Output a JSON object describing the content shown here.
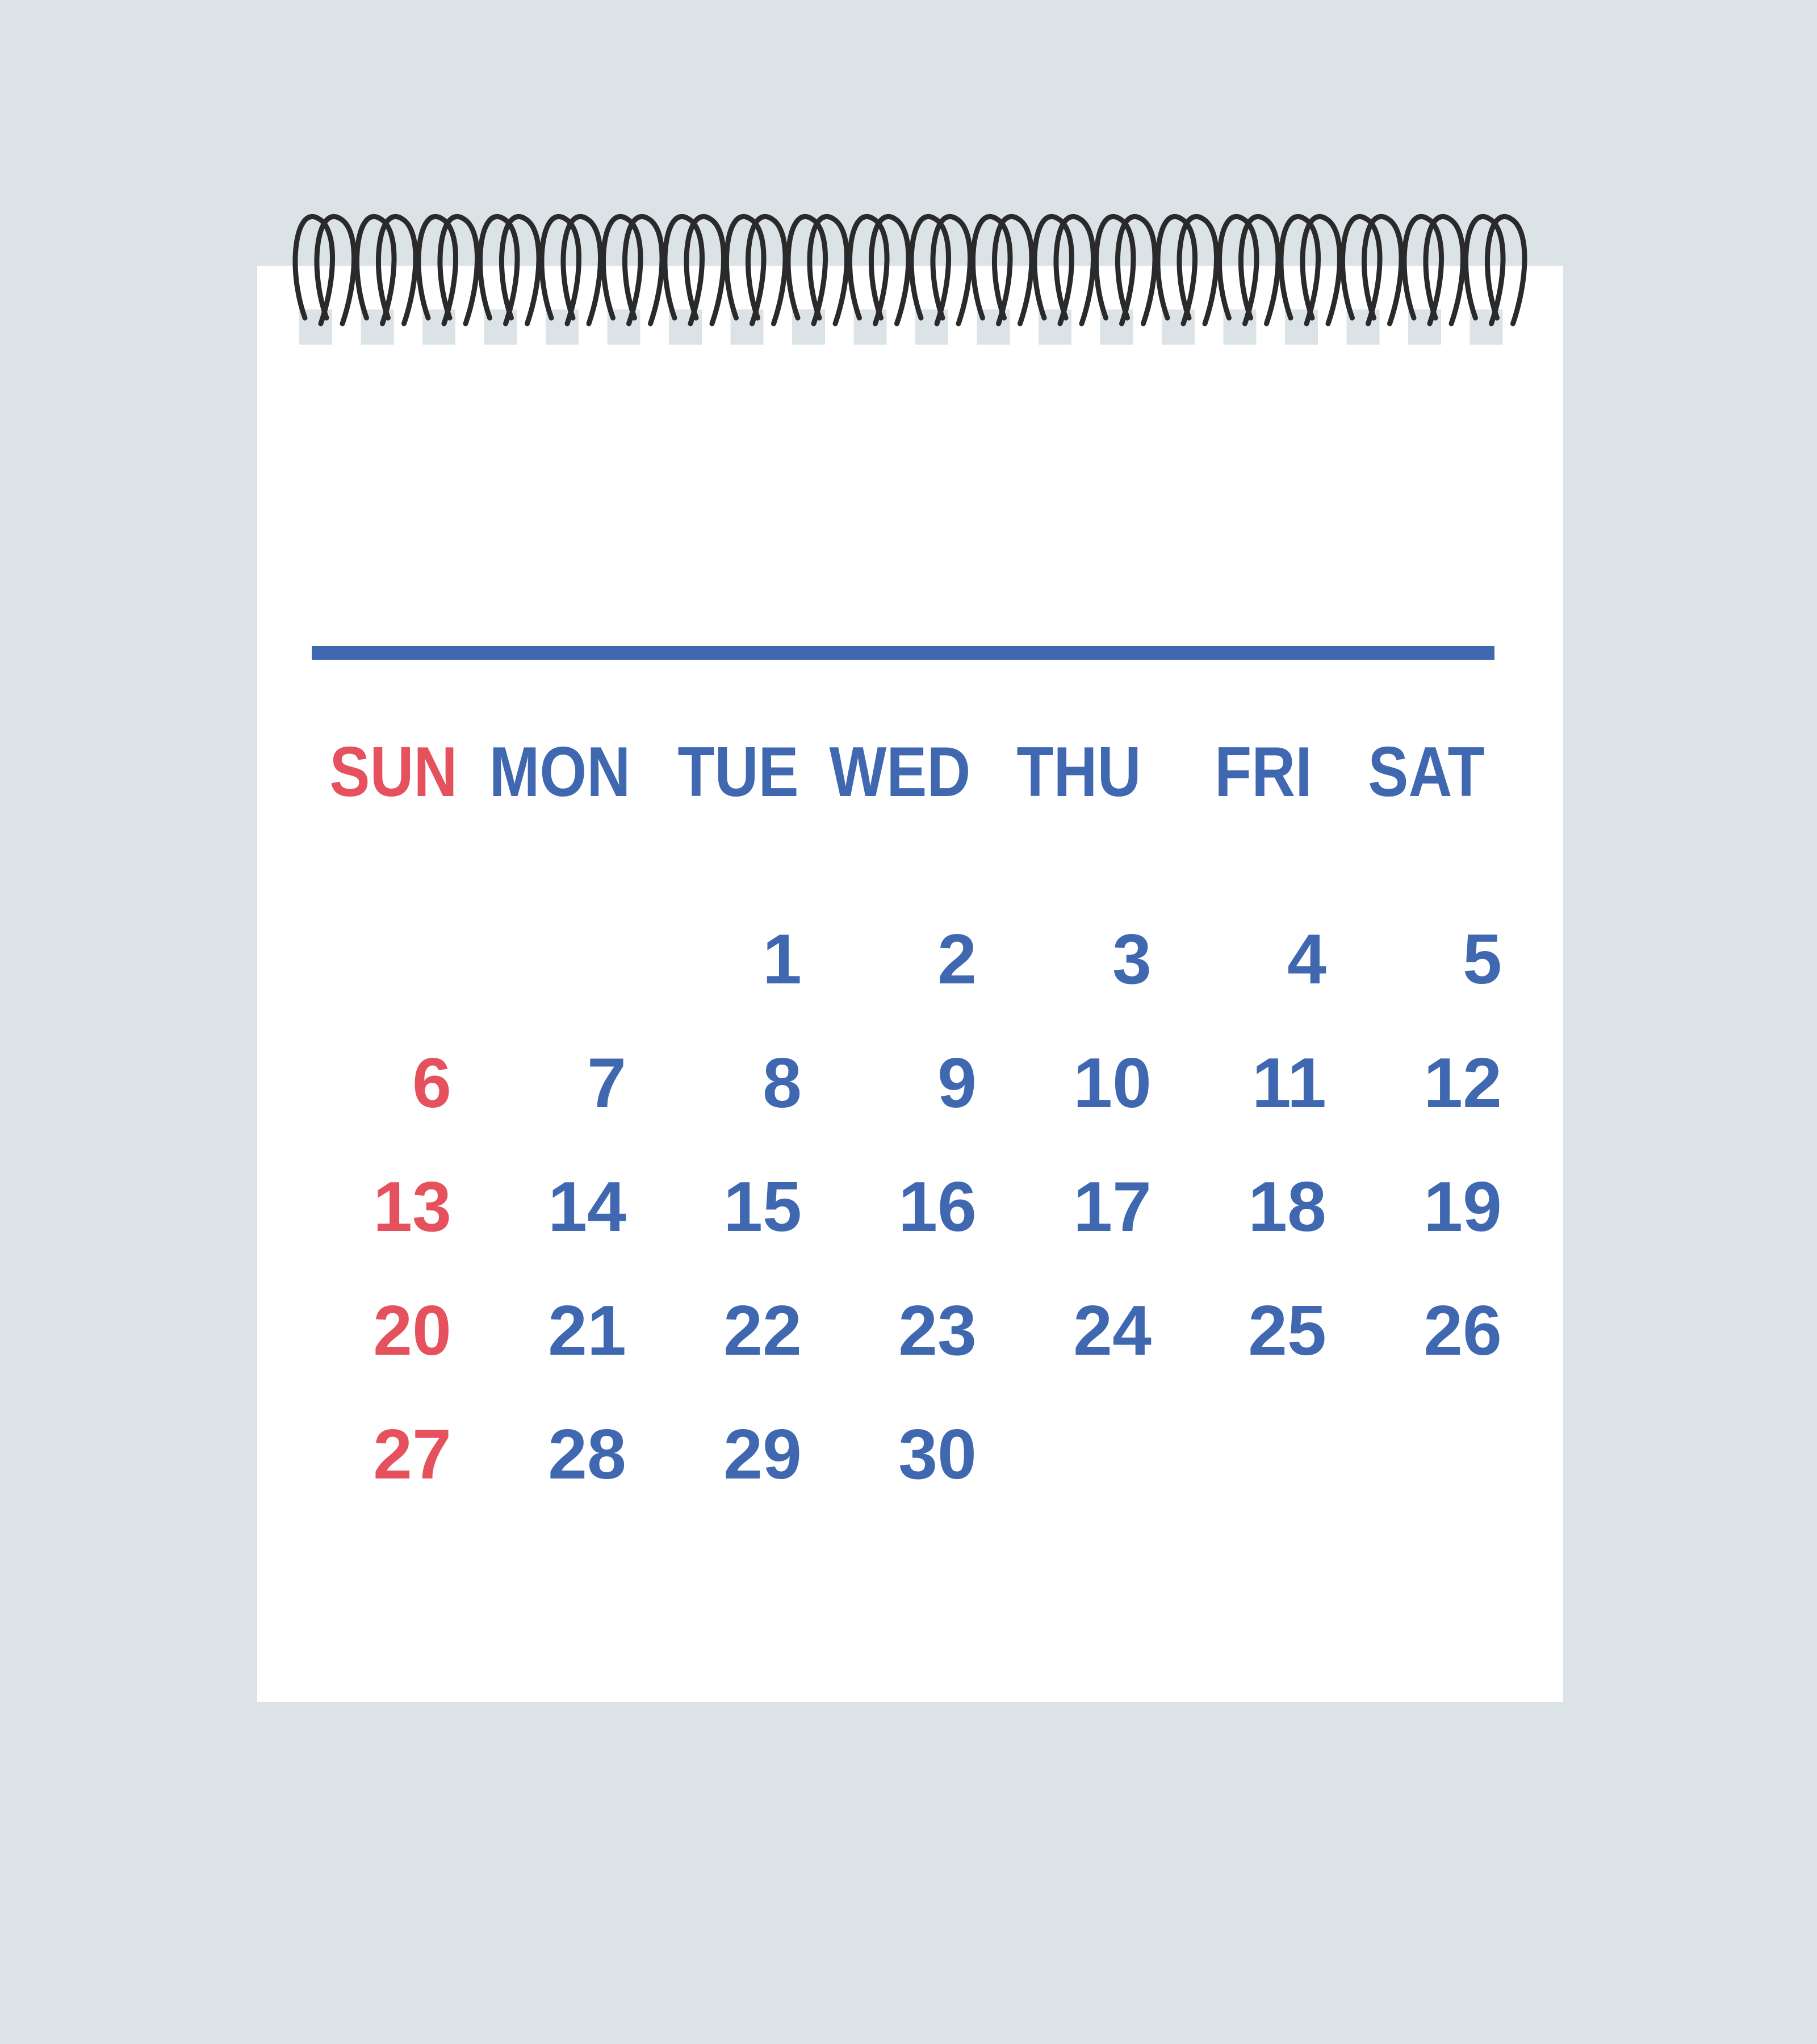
{
  "colors": {
    "background": "#dce3e7",
    "page": "#ffffff",
    "accent": "#4068b0",
    "weekend": "#e5525d",
    "spiral": "#2a2a2a"
  },
  "calendar": {
    "weekdays": [
      "SUN",
      "MON",
      "TUE",
      "WED",
      "THU",
      "FRI",
      "SAT"
    ],
    "first_weekday_index": 2,
    "days_in_month": 30,
    "highlight_weekday_index": 0
  },
  "binding": {
    "icon": "spiral-binding-icon",
    "rings": 20
  }
}
